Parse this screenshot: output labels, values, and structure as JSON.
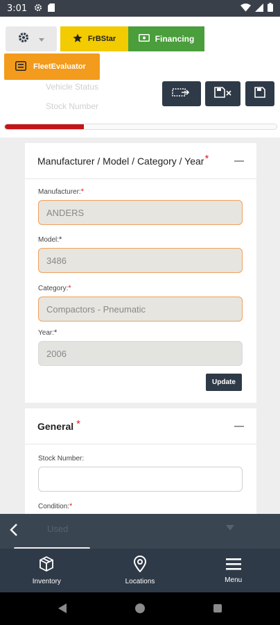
{
  "status_bar": {
    "time": "3:01"
  },
  "header": {
    "ghost_text_1": "Vehicle Status",
    "ghost_text_2": "Stock Number",
    "frbstar_label": "FrBStar",
    "financing_label": "Financing",
    "fleet_label": "FleetEvaluator",
    "progress_percent": 29
  },
  "section_mmcy": {
    "title": "Manufacturer / Model / Category / Year",
    "required_mark": "*",
    "manufacturer": {
      "label": "Manufacturer:",
      "value": "ANDERS"
    },
    "model": {
      "label": "Model:",
      "value": "3486"
    },
    "category": {
      "label": "Category:",
      "value": "Compactors - Pneumatic"
    },
    "year": {
      "label": "Year:",
      "value": "2006"
    },
    "update_label": "Update"
  },
  "section_general": {
    "title": "General",
    "required_mark": "*",
    "stock_number": {
      "label": "Stock Number:",
      "value": ""
    },
    "condition": {
      "label": "Condition:",
      "value": "Used"
    }
  },
  "bottom_nav": {
    "items": [
      {
        "label": "Inventory",
        "icon": "box-icon"
      },
      {
        "label": "Locations",
        "icon": "map-pin-icon"
      },
      {
        "label": "Menu",
        "icon": "hamburger-menu-icon"
      }
    ]
  },
  "colors": {
    "dark": "#2f3a48",
    "frbstar": "#f2cb00",
    "financing": "#4a9e3c",
    "fleet": "#f39b1c",
    "required": "#e02020",
    "progress": "#c41418"
  }
}
